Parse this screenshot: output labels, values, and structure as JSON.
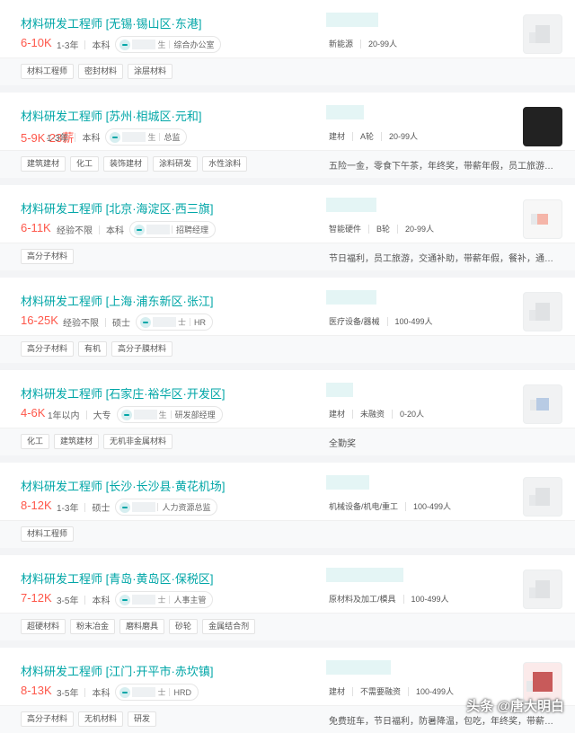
{
  "jobs": [
    {
      "title": "材料研发工程师 [无锡·锡山区·东港]",
      "salary": "6-10K",
      "bonus": "",
      "requirements": [
        "1-3年",
        "本科"
      ],
      "recruiter_surname": "生",
      "recruiter_title": "综合办公室",
      "company_meta": [
        "新能源",
        "20-99人"
      ],
      "logo": "building-icon",
      "tags": [
        "材料工程师",
        "密封材料",
        "涂层材料"
      ],
      "benefits": ""
    },
    {
      "title": "材料研发工程师 [苏州·相城区·元和]",
      "salary": "5-9K",
      "bonus": "·23薪",
      "requirements": [
        "1-3年",
        "本科"
      ],
      "recruiter_surname": "生",
      "recruiter_title": "总监",
      "company_meta": [
        "建材",
        "A轮",
        "20-99人"
      ],
      "logo": "dark-logo",
      "tags": [
        "建筑建材",
        "化工",
        "装饰建材",
        "涂料研发",
        "水性涂料"
      ],
      "benefits": "五险一金，零食下午茶，年终奖，带薪年假，员工旅游，…"
    },
    {
      "title": "材料研发工程师 [北京·海淀区·西三旗]",
      "salary": "6-11K",
      "bonus": "",
      "requirements": [
        "经验不限",
        "本科"
      ],
      "recruiter_surname": "",
      "recruiter_title": "招聘经理",
      "company_meta": [
        "智能硬件",
        "B轮",
        "20-99人"
      ],
      "logo": "pink-logo",
      "tags": [
        "高分子材料"
      ],
      "benefits": "节日福利，员工旅游，交通补助，带薪年假，餐补，通讯…"
    },
    {
      "title": "材料研发工程师 [上海·浦东新区·张江]",
      "salary": "16-25K",
      "bonus": "",
      "requirements": [
        "经验不限",
        "硕士"
      ],
      "recruiter_surname": "士",
      "recruiter_title": "HR",
      "company_meta": [
        "医疗设备/器械",
        "100-499人"
      ],
      "logo": "building-icon",
      "tags": [
        "高分子材料",
        "有机",
        "高分子膜材料"
      ],
      "benefits": ""
    },
    {
      "title": "材料研发工程师 [石家庄·裕华区·开发区]",
      "salary": "4-6K",
      "bonus": "",
      "requirements": [
        "1年以内",
        "大专"
      ],
      "recruiter_surname": "生",
      "recruiter_title": "研发部经理",
      "company_meta": [
        "建材",
        "未融资",
        "0-20人"
      ],
      "logo": "blue-logo",
      "tags": [
        "化工",
        "建筑建材",
        "无机非金属材料"
      ],
      "benefits": "全勤奖"
    },
    {
      "title": "材料研发工程师 [长沙·长沙县·黄花机场]",
      "salary": "8-12K",
      "bonus": "",
      "requirements": [
        "1-3年",
        "硕士"
      ],
      "recruiter_surname": "",
      "recruiter_title": "人力资源总监",
      "company_meta": [
        "机械设备/机电/重工",
        "100-499人"
      ],
      "logo": "building-icon",
      "tags": [
        "材料工程师"
      ],
      "benefits": ""
    },
    {
      "title": "材料研发工程师 [青岛·黄岛区·保税区]",
      "salary": "7-12K",
      "bonus": "",
      "requirements": [
        "3-5年",
        "本科"
      ],
      "recruiter_surname": "士",
      "recruiter_title": "人事主管",
      "company_meta": [
        "原材料及加工/模具",
        "100-499人"
      ],
      "logo": "building-icon",
      "tags": [
        "超硬材料",
        "粉末冶金",
        "磨料磨具",
        "砂轮",
        "金属结合剂"
      ],
      "benefits": ""
    },
    {
      "title": "材料研发工程师 [江门·开平市·赤坎镇]",
      "salary": "8-13K",
      "bonus": "",
      "requirements": [
        "3-5年",
        "本科"
      ],
      "recruiter_surname": "士",
      "recruiter_title": "HRD",
      "company_meta": [
        "建材",
        "不需要融资",
        "100-499人"
      ],
      "logo": "red-logo",
      "tags": [
        "高分子材料",
        "无机材料",
        "研发"
      ],
      "benefits": "免费班车，节日福利，防暑降温，包吃，年终奖，带薪年…"
    }
  ],
  "watermark": "头条 @唐大明白"
}
